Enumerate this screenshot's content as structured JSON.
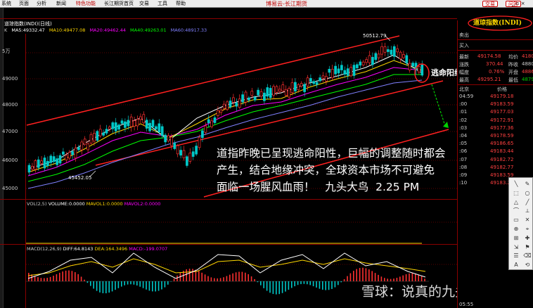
{
  "menu": {
    "items": [
      "系统",
      "页面",
      "分析",
      "新闻",
      "特色功能",
      "长江期货首页",
      "交易",
      "工具",
      "帮助"
    ],
    "active_index": 4
  },
  "app_title": "博易云-长江期货",
  "buttons": {
    "trade": "交易",
    "qa": "问答"
  },
  "window_controls": "_ ▫ ×",
  "chart": {
    "title": "道琼指数(INDI)(日线)",
    "k_label": "K",
    "ma": [
      {
        "label": "MA5:49332.47",
        "color": "#ffffff"
      },
      {
        "label": "MA10:49477.08",
        "color": "#ffd700"
      },
      {
        "label": "MA20:49462.44",
        "color": "#ff00ff"
      },
      {
        "label": "MA40:49263.01",
        "color": "#00ff00"
      },
      {
        "label": "MA60:48917.33",
        "color": "#8080ff"
      }
    ],
    "y_ticks": [
      "5万",
      "49000",
      "48000",
      "47000",
      "46000",
      "45000"
    ],
    "high_label": "50512.79",
    "low_label": "45452.05",
    "escape_label": "逃命阳线",
    "colors": {
      "up": "#ff3030",
      "down": "#00c8c8",
      "channel": "#ff2020",
      "arrow": "#00d000"
    }
  },
  "sub1": {
    "labels": [
      {
        "text": "VOL(2,5)",
        "color": "#cccccc"
      },
      {
        "text": "VOLUME:0.0000",
        "color": "#ffffff"
      },
      {
        "text": "MAVOL1:0.0000",
        "color": "#ffd700"
      },
      {
        "text": "MAVOL2:0.0000",
        "color": "#ff00ff"
      }
    ]
  },
  "sub2": {
    "labels": [
      {
        "text": "MACD(12,26,9)",
        "color": "#cccccc"
      },
      {
        "text": "DIFF:64.8143",
        "color": "#ffffff"
      },
      {
        "text": "DEA:164.3496",
        "color": "#ffd700"
      },
      {
        "text": "MACD:-199.0707",
        "color": "#ff00ff"
      }
    ]
  },
  "annotation": {
    "line1": "道指昨晚已呈现逃命阳性，巨幅的调整随时都会",
    "line2": "产生，结合地缘冲突，全球资本市场不可避免",
    "line3": "面临一场腥风血雨！   九头大鸟  2.25 PM"
  },
  "watermark": "雪球：说真的九头鸟",
  "right_panel": {
    "title": "道琼指数(INDI)",
    "sell_label": "卖出",
    "buy_label": "买入",
    "rows": [
      {
        "l1": "最新",
        "v1": "49174.58",
        "c1": "#ff4040",
        "l2": "均价",
        "v2": "4180",
        "c2": "#ff4040"
      },
      {
        "l1": "涨跌",
        "v1": "370.44",
        "c1": "#ff4040",
        "l2": "昨收",
        "v2": "4880",
        "c2": "#cccccc"
      },
      {
        "l1": "幅度",
        "v1": "0.76%",
        "c1": "#ff4040",
        "l2": "开盘",
        "v2": "4886",
        "c2": "#ff4040"
      },
      {
        "l1": "最高",
        "v1": "49295.21",
        "c1": "#ff4040",
        "l2": "最低",
        "v2": "4879",
        "c2": "#00d000"
      }
    ],
    "list_header": {
      "left": "北京",
      "right": "价格"
    },
    "ticks": [
      {
        "time": "04:59",
        "price": "49179.18"
      },
      {
        "time": ":00",
        "price": "49183.59"
      },
      {
        "time": ":01",
        "price": "49177.03"
      },
      {
        "time": ":02",
        "price": "49172.91"
      },
      {
        "time": ":03",
        "price": "49177.36"
      },
      {
        "time": ":04",
        "price": "49178.59"
      },
      {
        "time": ":05",
        "price": "49186.65"
      },
      {
        "time": ":06",
        "price": "49183.44"
      },
      {
        "time": ":07",
        "price": "49182.72"
      },
      {
        "time": ":08",
        "price": "49182.77"
      },
      {
        "time": ":09",
        "price": "49183.59"
      },
      {
        "time": ":10",
        "price": "49183.26"
      }
    ],
    "bottom_time": "05:55"
  },
  "drawing_tools": [
    "╲",
    "✎",
    "⬚",
    "○",
    "△",
    "╱",
    "⌒",
    "⟂",
    "▭",
    "✕",
    "⊕",
    "⌖",
    "⊞",
    "✚",
    "⇲",
    "⚑",
    "☰",
    "⌫",
    "A",
    "⟲"
  ]
}
